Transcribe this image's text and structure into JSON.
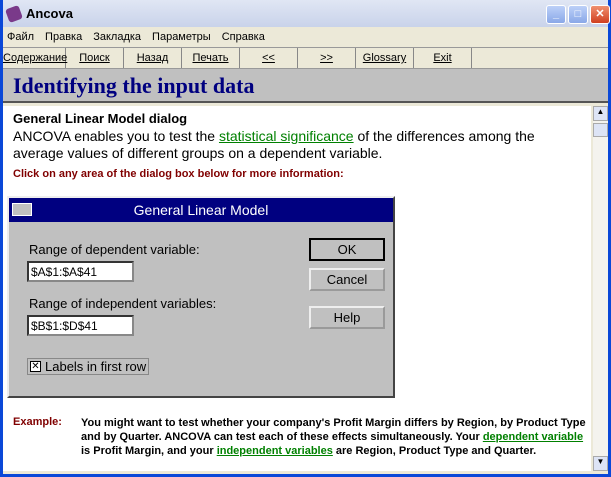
{
  "window": {
    "title": "Ancova"
  },
  "menu": [
    "Файл",
    "Правка",
    "Закладка",
    "Параметры",
    "Справка"
  ],
  "toolbar": [
    "Содержание",
    "Поиск",
    "Назад",
    "Печать",
    "<<",
    ">>",
    "Glossary",
    "Exit"
  ],
  "header": "Identifying the input data",
  "content": {
    "heading": "General Linear Model dialog",
    "intro_a": "ANCOVA enables you to test the ",
    "intro_link": "statistical significance",
    "intro_b": " of the differences among the average values of different groups on a dependent variable.",
    "click": "Click on any area of the dialog box below for more information:"
  },
  "dialog": {
    "title": "General Linear Model",
    "dep_label": "Range of dependent variable:",
    "dep_value": "$A$1:$A$41",
    "ind_label": "Range of independent variables:",
    "ind_value": "$B$1:$D$41",
    "ok": "OK",
    "cancel": "Cancel",
    "help": "Help",
    "checkbox_label": "Labels in first row",
    "checkbox_checked": true
  },
  "example": {
    "label": "Example:",
    "t1": "You might want to test whether your company's Profit Margin differs by Region, by Product Type and by Quarter. ANCOVA can test each of these effects simultaneously. Your ",
    "l1": "dependent variable",
    "t2": " is Profit Margin, and your ",
    "l2": "independent variables",
    "t3": " are Region, Product Type and Quarter."
  }
}
